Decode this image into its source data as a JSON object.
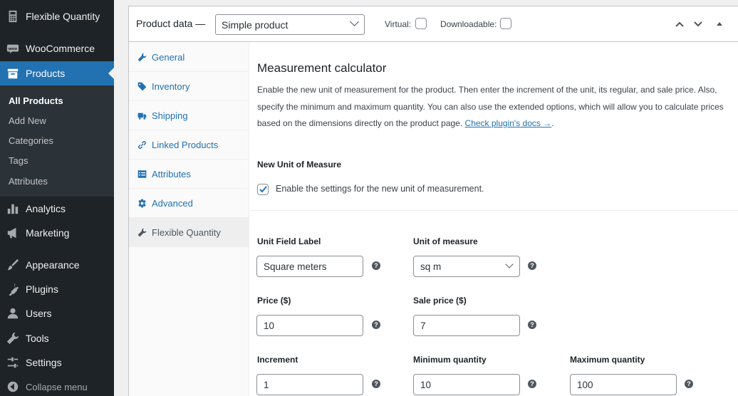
{
  "sidebar": {
    "items": [
      {
        "label": "Flexible Quantity",
        "icon": "calculator-icon"
      },
      {
        "label": "WooCommerce",
        "icon": "woocommerce-icon"
      },
      {
        "label": "Products",
        "icon": "archive-icon"
      },
      {
        "label": "Analytics",
        "icon": "chart-bar-icon"
      },
      {
        "label": "Marketing",
        "icon": "megaphone-icon"
      },
      {
        "label": "Appearance",
        "icon": "paintbrush-icon"
      },
      {
        "label": "Plugins",
        "icon": "plug-icon"
      },
      {
        "label": "Users",
        "icon": "user-icon"
      },
      {
        "label": "Tools",
        "icon": "wrench-icon"
      },
      {
        "label": "Settings",
        "icon": "sliders-icon"
      }
    ],
    "submenu": [
      "All Products",
      "Add New",
      "Categories",
      "Tags",
      "Attributes"
    ],
    "collapse_label": "Collapse menu",
    "accent_color": "#2271b1"
  },
  "product_data": {
    "title": "Product data —",
    "type_select": "Simple product",
    "virtual_label": "Virtual:",
    "downloadable_label": "Downloadable:"
  },
  "tabs": [
    {
      "label": "General",
      "icon": "wrench-icon"
    },
    {
      "label": "Inventory",
      "icon": "tag-icon"
    },
    {
      "label": "Shipping",
      "icon": "truck-icon"
    },
    {
      "label": "Linked Products",
      "icon": "link-icon"
    },
    {
      "label": "Attributes",
      "icon": "list-icon"
    },
    {
      "label": "Advanced",
      "icon": "gear-icon"
    },
    {
      "label": "Flexible Quantity",
      "icon": "wrench-icon"
    }
  ],
  "panel": {
    "title": "Measurement calculator",
    "description": "Enable the new unit of measurement for the product. Then enter the increment of the unit, its regular, and sale price. Also, specify the minimum and maximum quantity. You can also use the extended options, which will allow you to calculate prices based on the dimensions directly on the product page. ",
    "docs_link": "Check plugin's docs →",
    "docs_link_end": ".",
    "new_unit_heading": "New Unit of Measure",
    "enable_checkbox_label": "Enable the settings for the new unit of measurement.",
    "enable_checked": true,
    "fields": {
      "unit_field_label": {
        "label": "Unit Field Label",
        "value": "Square meters"
      },
      "unit_of_measure": {
        "label": "Unit of measure",
        "value": "sq m"
      },
      "price": {
        "label": "Price ($)",
        "value": "10"
      },
      "sale_price": {
        "label": "Sale price ($)",
        "value": "7"
      },
      "increment": {
        "label": "Increment",
        "value": "1"
      },
      "min_qty": {
        "label": "Minimum quantity",
        "value": "10"
      },
      "max_qty": {
        "label": "Maximum quantity",
        "value": "100"
      }
    },
    "help_glyph": "?"
  }
}
